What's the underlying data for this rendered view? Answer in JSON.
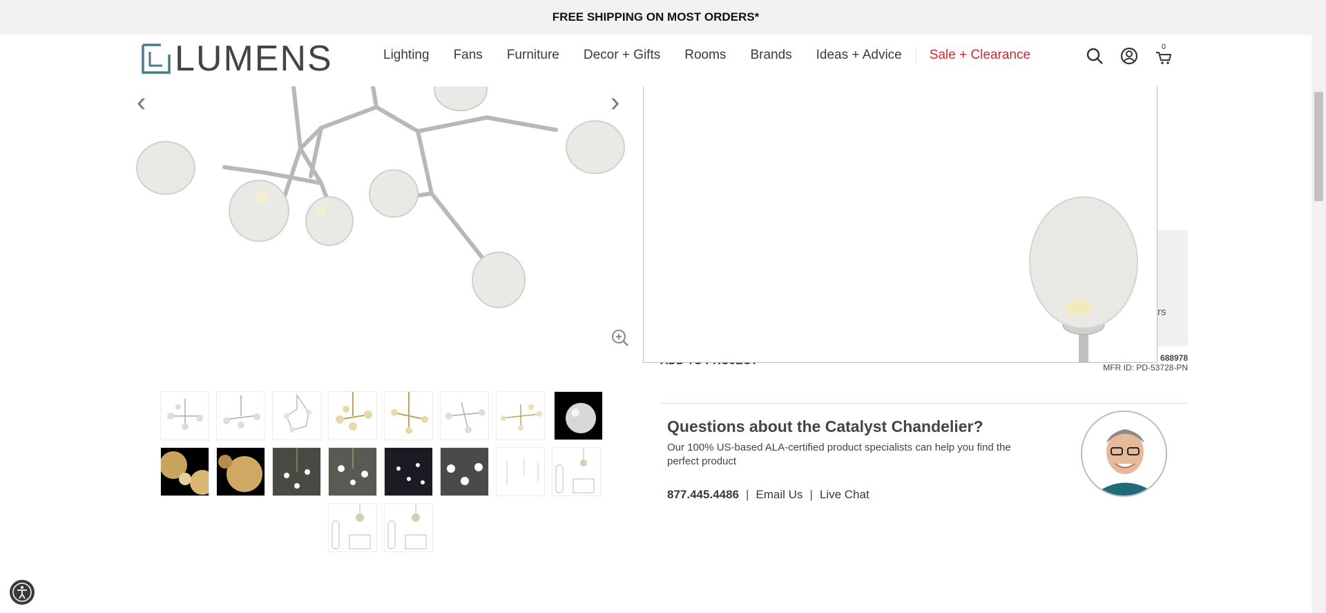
{
  "promo": {
    "text": "FREE SHIPPING ON MOST ORDERS*"
  },
  "header": {
    "logo_text": "LUMENS",
    "nav": [
      "Lighting",
      "Fans",
      "Furniture",
      "Decor + Gifts",
      "Rooms",
      "Brands",
      "Ideas + Advice"
    ],
    "sale_label": "Sale + Clearance",
    "cart_count": "0",
    "icons": [
      "search-icon",
      "account-icon",
      "cart-icon"
    ]
  },
  "gallery": {
    "prev_icon": "chevron-left-icon",
    "next_icon": "chevron-right-icon",
    "zoom_icon": "zoom-in-icon"
  },
  "product": {
    "add_to_project": "ADD TO PROJECT",
    "sku_partial": "688978",
    "mfr_id": "MFR ID: PD-53728-PN",
    "side_text_fragment": "rs"
  },
  "questions": {
    "title": "Questions about the Catalyst Chandelier?",
    "description": "Our 100% US-based ALA-certified product specialists can help you find the perfect product",
    "phone": "877.445.4486",
    "email_label": "Email Us",
    "chat_label": "Live Chat"
  },
  "colors": {
    "sale": "#d6242c",
    "logo_accent": "#4a7b8c"
  }
}
